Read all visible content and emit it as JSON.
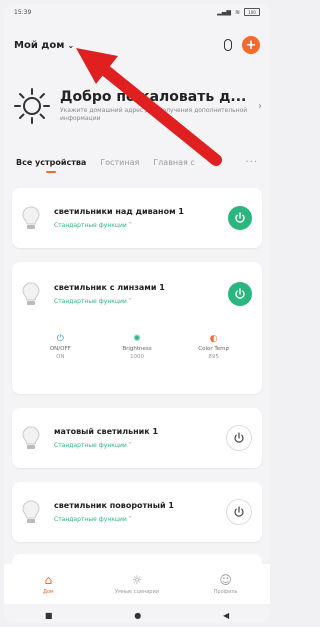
{
  "status_bar": {
    "time": "15:39",
    "battery": "100"
  },
  "header": {
    "home_label": "Мой дом",
    "chevron_icon": "chevron-down-icon",
    "accent": "#f26a2e"
  },
  "welcome": {
    "title": "Добро пожаловать д...",
    "subtitle": "Укажите домашний адрес для получения дополнительной информации",
    "icon": "sun-icon"
  },
  "tabs": [
    {
      "label": "Все устройства",
      "active": true
    },
    {
      "label": "Гостиная",
      "active": false
    },
    {
      "label": "Главная с",
      "active": false
    }
  ],
  "devices": [
    {
      "name": "светильники над диваном 1",
      "func": "Стандартные функции ˅",
      "power": "on"
    },
    {
      "name": "светильник с линзами 1",
      "func": "Стандартные функции ˅",
      "power": "on",
      "controls": [
        {
          "label": "ON/OFF",
          "value": "ON",
          "icon": "power-icon"
        },
        {
          "label": "Brightness",
          "value": "1000",
          "icon": "brightness-icon"
        },
        {
          "label": "Color Temp",
          "value": "895",
          "icon": "color-temp-icon"
        }
      ]
    },
    {
      "name": "матовый светильник 1",
      "func": "Стандартные функции ˅",
      "power": "off"
    },
    {
      "name": "светильник поворотный 1",
      "func": "Стандартные функции ˅",
      "power": "off"
    }
  ],
  "bottom_nav": [
    {
      "label": "Дом",
      "icon": "home-icon",
      "active": true
    },
    {
      "label": "Умные сценарии",
      "icon": "scenes-icon",
      "active": false
    },
    {
      "label": "Профиль",
      "icon": "profile-icon",
      "active": false
    }
  ],
  "colors": {
    "power_on": "#2bb57f",
    "annotation_arrow": "#e02020"
  }
}
